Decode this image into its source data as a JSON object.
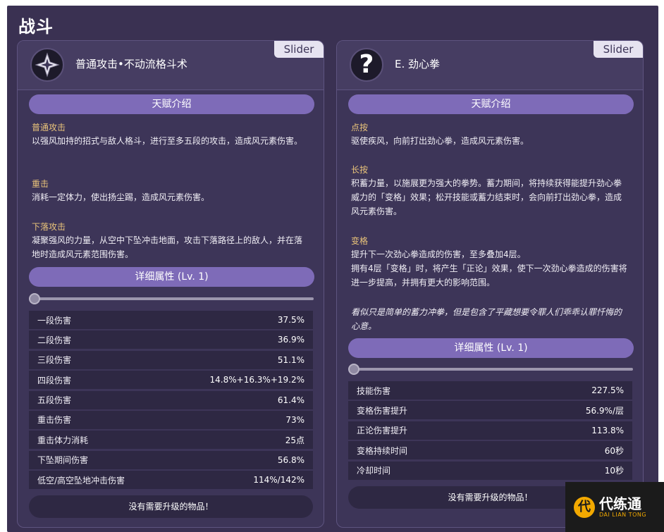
{
  "section": {
    "title": "战斗"
  },
  "left": {
    "tag": "Slider",
    "icon": "anemo-star-icon",
    "name": "普通攻击•不动流格斗术",
    "intro_label": "天赋介绍",
    "paragraphs": [
      {
        "title": "普通攻击",
        "text": "以强风加持的招式与敌人格斗，进行至多五段的攻击，造成风元素伤害。"
      },
      {
        "title": "重击",
        "text": "消耗一定体力，使出扬尘踢，造成风元素伤害。"
      },
      {
        "title": "下落攻击",
        "text": "凝聚强风的力量，从空中下坠冲击地面，攻击下落路径上的敌人，并在落地时造成风元素范围伤害。"
      }
    ],
    "attr_label": "详细属性 (Lv. 1)",
    "level_fraction": 0,
    "stats": [
      {
        "label": "一段伤害",
        "value": "37.5%"
      },
      {
        "label": "二段伤害",
        "value": "36.9%"
      },
      {
        "label": "三段伤害",
        "value": "51.1%"
      },
      {
        "label": "四段伤害",
        "value": "14.8%+16.3%+19.2%"
      },
      {
        "label": "五段伤害",
        "value": "61.4%"
      },
      {
        "label": "重击伤害",
        "value": "73%"
      },
      {
        "label": "重击体力消耗",
        "value": "25点"
      },
      {
        "label": "下坠期间伤害",
        "value": "56.8%"
      },
      {
        "label": "低空/高空坠地冲击伤害",
        "value": "114%/142%"
      }
    ],
    "footer": "没有需要升级的物品！"
  },
  "right": {
    "tag": "Slider",
    "icon": "question-icon",
    "icon_glyph": "?",
    "name": "E. 劲心拳",
    "intro_label": "天赋介绍",
    "paragraphs": [
      {
        "title": "点按",
        "text": "驱使疾风，向前打出劲心拳，造成风元素伤害。"
      },
      {
        "title": "长按",
        "text": "积蓄力量，以施展更为强大的拳势。蓄力期间，将持续获得能提升劲心拳威力的「变格」效果；松开技能或蓄力结束时，会向前打出劲心拳，造成风元素伤害。"
      },
      {
        "title": "变格",
        "text": "提升下一次劲心拳造成的伤害，至多叠加4层。\n拥有4层「变格」时，将产生「正论」效果，使下一次劲心拳造成的伤害将进一步提高，并拥有更大的影响范围。"
      }
    ],
    "flavor": "看似只是简单的蓄力冲拳，但是包含了平藏想要令罪人们乖乖认罪忏悔的心意。",
    "attr_label": "详细属性 (Lv. 1)",
    "level_fraction": 0,
    "stats": [
      {
        "label": "技能伤害",
        "value": "227.5%"
      },
      {
        "label": "变格伤害提升",
        "value": "56.9%/层"
      },
      {
        "label": "正论伤害提升",
        "value": "113.8%"
      },
      {
        "label": "变格持续时间",
        "value": "60秒"
      },
      {
        "label": "冷却时间",
        "value": "10秒"
      }
    ],
    "footer": "没有需要升级的物品！"
  },
  "watermark": {
    "logo": "代",
    "main": "代练通",
    "sub": "DAI LIAN TONG"
  }
}
